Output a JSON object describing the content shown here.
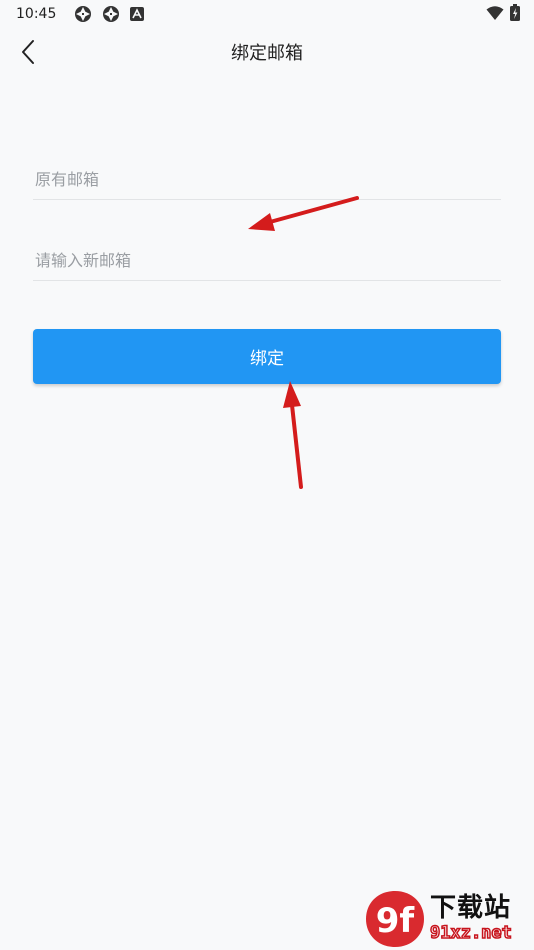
{
  "status_bar": {
    "time": "10:45",
    "icons": [
      "aperture-icon",
      "aperture-icon",
      "app-a-icon"
    ],
    "right_icons": [
      "wifi-icon",
      "battery-charging-icon"
    ]
  },
  "header": {
    "back_icon": "chevron-left-icon",
    "title": "绑定邮箱"
  },
  "form": {
    "old_email": {
      "value": "",
      "placeholder": "原有邮箱"
    },
    "new_email": {
      "value": "",
      "placeholder": "请输入新邮箱"
    },
    "bind_label": "绑定"
  },
  "watermark": {
    "logo_text": "9f",
    "title": "下载站",
    "domain": "91xz.net"
  },
  "colors": {
    "background": "#f8f9fa",
    "primary": "#2196f3",
    "annotation_arrow": "#d41c1c",
    "watermark_red": "#c7141d"
  }
}
